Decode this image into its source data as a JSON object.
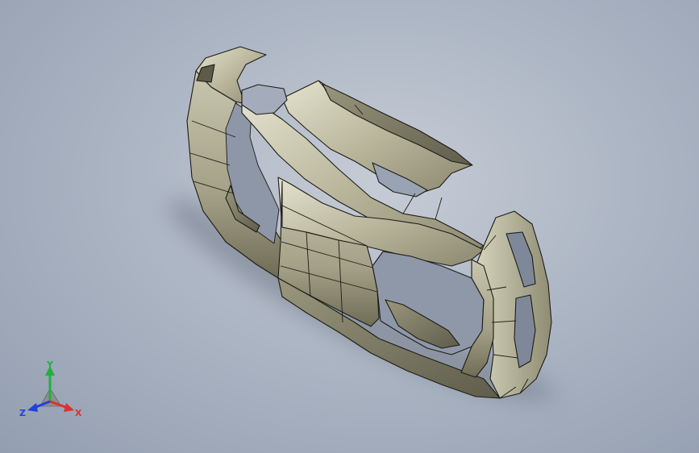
{
  "viewport": {
    "model": "car-body-shell",
    "colors": {
      "background_center": "#c6ccd6",
      "background_edge": "#939eb0",
      "surface": "#b4b197",
      "surface_dark": "#7e7b63",
      "surface_light": "#e2e0cc",
      "edge": "#1c1c16"
    }
  },
  "triad": {
    "x_label": "X",
    "y_label": "Y",
    "z_label": "Z",
    "x_color": "#e03030",
    "y_color": "#20b040",
    "z_color": "#2040e0"
  }
}
